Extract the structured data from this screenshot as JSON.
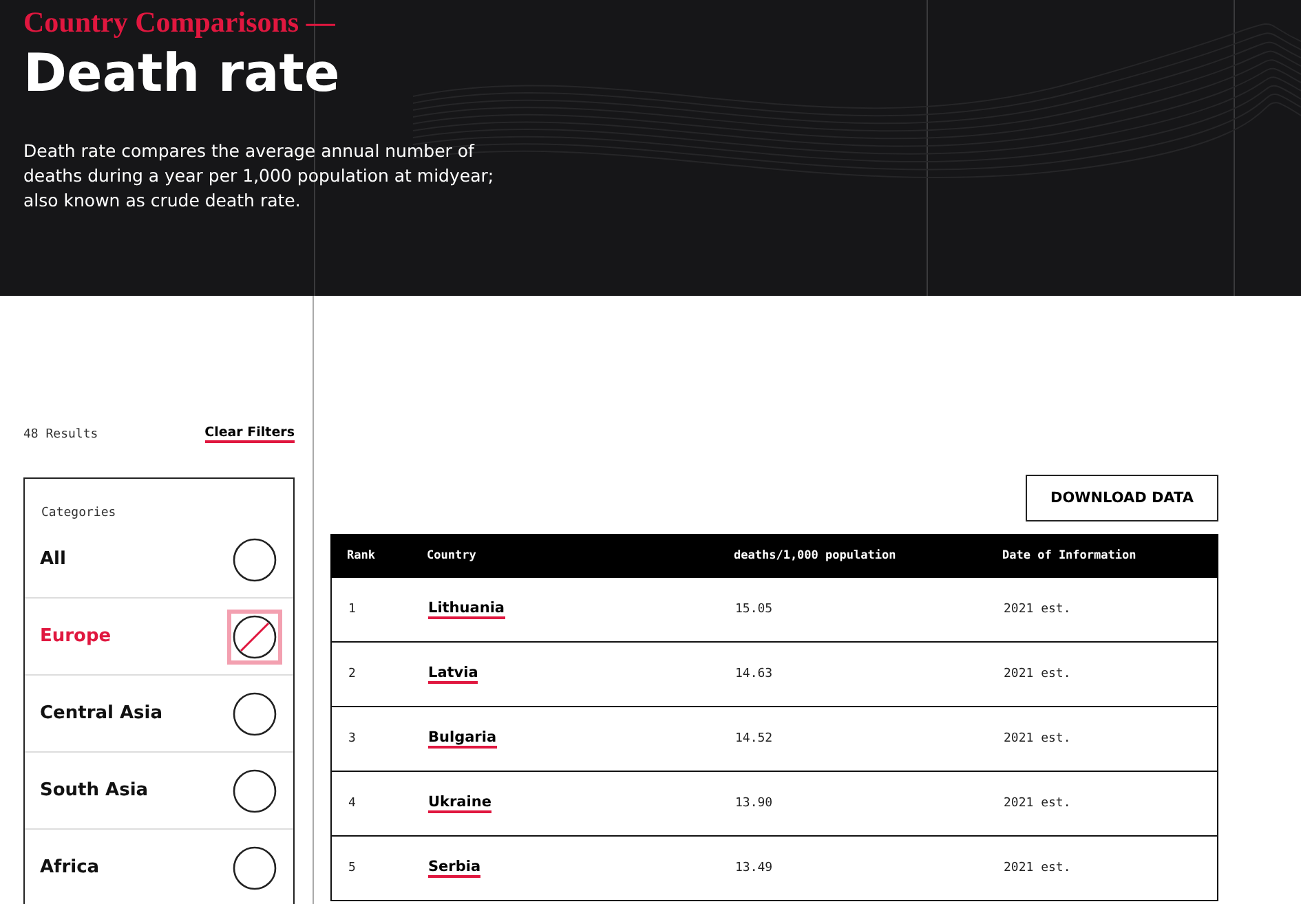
{
  "header": {
    "kicker": "Country Comparisons —",
    "title": "Death rate",
    "description": "Death rate compares the average annual number of deaths during a year per 1,000 population at midyear; also known as crude death rate."
  },
  "filters": {
    "results": "48 Results",
    "clear": "Clear Filters",
    "heading": "Categories",
    "categories": [
      {
        "label": "All",
        "selected": false
      },
      {
        "label": "Europe",
        "selected": true
      },
      {
        "label": "Central Asia",
        "selected": false
      },
      {
        "label": "South Asia",
        "selected": false
      },
      {
        "label": "Africa",
        "selected": false
      }
    ]
  },
  "download": "DOWNLOAD DATA",
  "table": {
    "columns": [
      "Rank",
      "Country",
      "deaths/1,000 population",
      "Date of Information"
    ],
    "rows": [
      {
        "rank": "1",
        "country": "Lithuania",
        "value": "15.05",
        "date": "2021 est."
      },
      {
        "rank": "2",
        "country": "Latvia",
        "value": "14.63",
        "date": "2021 est."
      },
      {
        "rank": "3",
        "country": "Bulgaria",
        "value": "14.52",
        "date": "2021 est."
      },
      {
        "rank": "4",
        "country": "Ukraine",
        "value": "13.90",
        "date": "2021 est."
      },
      {
        "rank": "5",
        "country": "Serbia",
        "value": "13.49",
        "date": "2021 est."
      }
    ]
  }
}
